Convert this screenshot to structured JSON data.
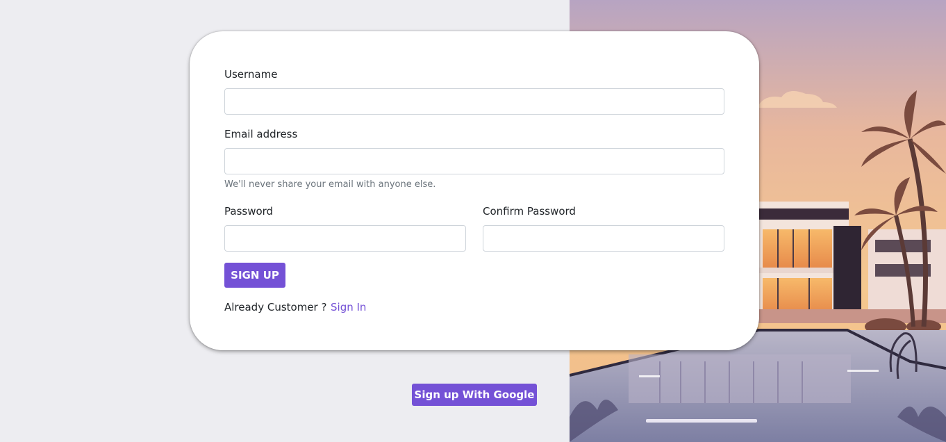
{
  "form": {
    "username_label": "Username",
    "username_value": "",
    "email_label": "Email address",
    "email_value": "",
    "email_help": "We'll never share your email with anyone else.",
    "password_label": "Password",
    "password_value": "",
    "confirm_password_label": "Confirm Password",
    "confirm_password_value": "",
    "submit_label": "SIGN UP",
    "already_customer_text": "Already Customer ?",
    "sign_in_link": "Sign In"
  },
  "google_button_label": "Sign up With Google",
  "colors": {
    "accent": "#7451d6",
    "page_background": "#ededf1",
    "card_background": "#ffffff"
  }
}
